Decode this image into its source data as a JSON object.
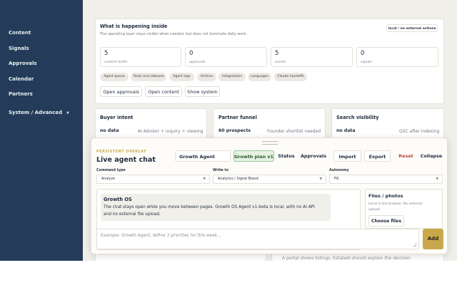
{
  "sidebar": {
    "items": [
      {
        "label": "Content"
      },
      {
        "label": "Signals"
      },
      {
        "label": "Approvals"
      },
      {
        "label": "Calendar"
      },
      {
        "label": "Partners"
      },
      {
        "label": "System / Advanced"
      }
    ]
  },
  "inside": {
    "title": "What is happening inside",
    "subtitle": "The operating layer stays visible when needed, but does not dominate daily work.",
    "badge": "local / no external actions",
    "stats": [
      {
        "value": "5",
        "label": "content drafts"
      },
      {
        "value": "0",
        "label": "approvals"
      },
      {
        "value": "5",
        "label": "events"
      },
      {
        "value": "0",
        "label": "signals"
      }
    ],
    "chips": [
      "Agent queue",
      "Tasks and statuses",
      "Agent logs",
      "Archive",
      "Integrations",
      "Languages",
      "Claude handoffs"
    ],
    "buttons": [
      "Open approvals",
      "Open content",
      "Show system"
    ]
  },
  "panels": [
    {
      "title": "Buyer intent",
      "value": "no data",
      "note": "AI Advisor + inquiry + viewing"
    },
    {
      "title": "Partner funnel",
      "value": "60 prospects",
      "note": "Founder shortlist needed"
    },
    {
      "title": "Search visibility",
      "value": "no data",
      "note": "GSC after indexing"
    }
  ],
  "behind_text": "A portal shows listings. EstateAI  should explain the decision",
  "overlay": {
    "eyebrow": "PERSISTENT OVERLAY",
    "title": "Live agent chat",
    "agent_select": "Growth Agent",
    "plan_button": "Growth plan v1",
    "buttons": [
      "Status",
      "Approvals",
      "Import",
      "Export",
      "Reset",
      "Collapse"
    ],
    "command_type": {
      "label": "Command type",
      "value": "Analyze"
    },
    "write_to": {
      "label": "Write to",
      "value": "Analytics / Signal Board"
    },
    "autonomy": {
      "label": "Autonomy",
      "value": "Fill"
    },
    "message": {
      "author": "Growth OS",
      "text_line1": "The chat stays open while you move between pages. Growth OS Agent v1-beta is local, with no AI API",
      "text_line2": "and no external file upload."
    },
    "files": {
      "title": "Files / photos",
      "note_line1": "Local in the browser. No external",
      "note_line2": "upload.",
      "button": "Choose files"
    },
    "input_placeholder": "Example: Growth Agent, define 3 priorities for this week...",
    "add_button": "Add"
  },
  "colors": {
    "sidebar": "#243c5a",
    "accent_gold": "#c9a84c",
    "accent_green": "#e6f2e4",
    "reset_red": "#b84a3a"
  }
}
